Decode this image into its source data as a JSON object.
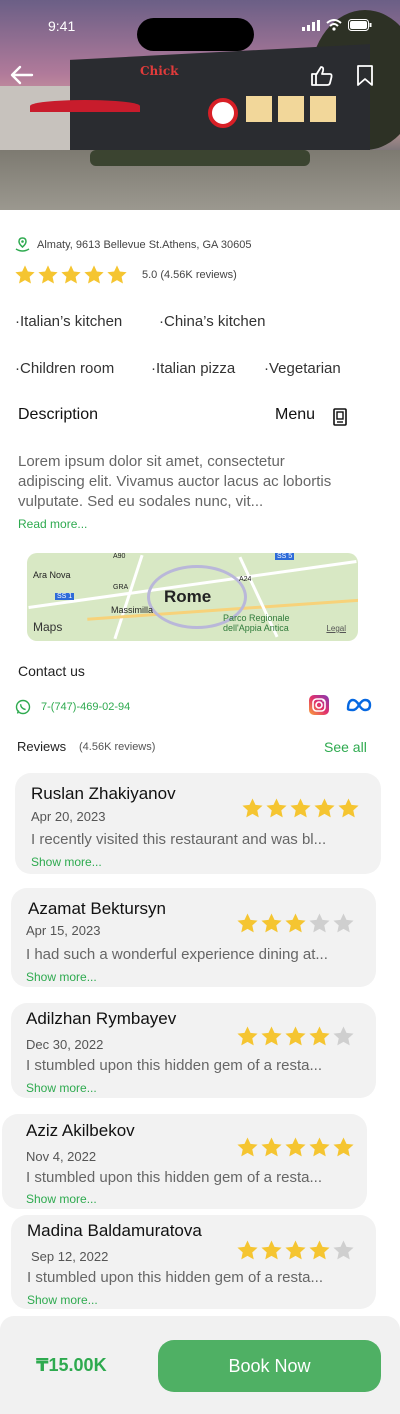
{
  "status_bar": {
    "time": "9:41"
  },
  "restaurant": {
    "address": "Almaty, 9613 Bellevue St.Athens, GA 30605",
    "rating_value": 5,
    "rating_text": "5.0 (4.56K reviews)",
    "sign_text": "Chick"
  },
  "tags": [
    "·Italian’s kitchen",
    "·China’s kitchen",
    "·Children room",
    "·Italian pizza",
    "·Vegetarian"
  ],
  "description": {
    "title": "Description",
    "menu_label": "Menu",
    "text": "Lorem ipsum dolor sit amet, consectetur adipiscing elit. Vivamus auctor lacus ac lobortis vulputate. Sed eu sodales nunc, vit...",
    "read_more": "Read more..."
  },
  "map": {
    "city": "Rome",
    "labels": [
      "Ara Nova",
      "Massimilla",
      "A90",
      "GRA",
      "SS 1",
      "A24",
      "SS 5"
    ],
    "park": "Parco Regionale dell'Appia Antica",
    "brand": "Maps",
    "legal": "Legal"
  },
  "contact": {
    "title": "Contact us",
    "phone": "7-(747)-469-02-94"
  },
  "reviews_section": {
    "title": "Reviews",
    "count": "(4.56K reviews)",
    "see_all": "See all"
  },
  "reviews": [
    {
      "name": "Ruslan Zhakiyanov",
      "date": "Apr 20, 2023",
      "stars": 5,
      "text": "I recently visited this restaurant and was bl...",
      "more": "Show more..."
    },
    {
      "name": "Azamat Bektursyn",
      "date": "Apr 15, 2023",
      "stars": 3,
      "text": "I had such a wonderful experience dining at...",
      "more": "Show more..."
    },
    {
      "name": "Adilzhan Rymbayev",
      "date": "Dec 30, 2022",
      "stars": 4,
      "text": "I stumbled upon this hidden gem of a resta...",
      "more": "Show more..."
    },
    {
      "name": "Aziz Akilbekov",
      "date": "Nov 4, 2022",
      "stars": 5,
      "text": "I stumbled upon this hidden gem of a resta...",
      "more": "Show more..."
    },
    {
      "name": "Madina Baldamuratova",
      "date": "Sep 12, 2022",
      "stars": 4,
      "text": "I stumbled upon this hidden gem of a resta...",
      "more": "Show more..."
    }
  ],
  "booking": {
    "price": "₸15.00K",
    "button": "Book Now"
  },
  "colors": {
    "accent": "#2eaa4f",
    "button": "#4fb064",
    "star": "#f5c531",
    "star_empty": "#cfcfcf"
  }
}
